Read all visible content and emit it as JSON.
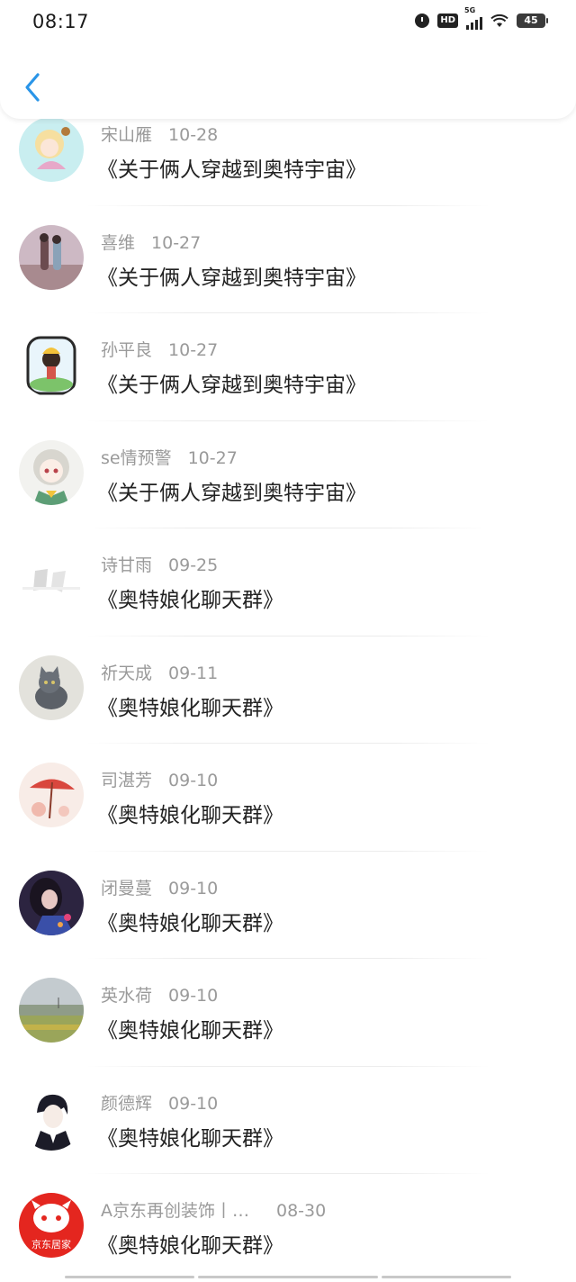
{
  "status_bar": {
    "time": "08:17",
    "hd_label": "HD",
    "network_label": "5G",
    "battery": "45"
  },
  "nav": {
    "back_icon": "chevron-left-icon",
    "accent_color": "#2a95e8"
  },
  "items": [
    {
      "name": "宋山雁",
      "date": "10-28",
      "title": "《关于俩人穿越到奥特宇宙》"
    },
    {
      "name": "喜维",
      "date": "10-27",
      "title": "《关于俩人穿越到奥特宇宙》"
    },
    {
      "name": "孙平良",
      "date": "10-27",
      "title": "《关于俩人穿越到奥特宇宙》"
    },
    {
      "name": "se情预警",
      "date": "10-27",
      "title": "《关于俩人穿越到奥特宇宙》"
    },
    {
      "name": "诗甘雨",
      "date": "09-25",
      "title": "《奥特娘化聊天群》"
    },
    {
      "name": "祈天成",
      "date": "09-11",
      "title": "《奥特娘化聊天群》"
    },
    {
      "name": "司湛芳",
      "date": "09-10",
      "title": "《奥特娘化聊天群》"
    },
    {
      "name": "闭曼蔓",
      "date": "09-10",
      "title": "《奥特娘化聊天群》"
    },
    {
      "name": "英水荷",
      "date": "09-10",
      "title": "《奥特娘化聊天群》"
    },
    {
      "name": "颜德辉",
      "date": "09-10",
      "title": "《奥特娘化聊天群》"
    },
    {
      "name": "A京东再创装饰丨…",
      "date": "08-30",
      "title": "《奥特娘化聊天群》",
      "avatar_text": "京东居家"
    }
  ]
}
